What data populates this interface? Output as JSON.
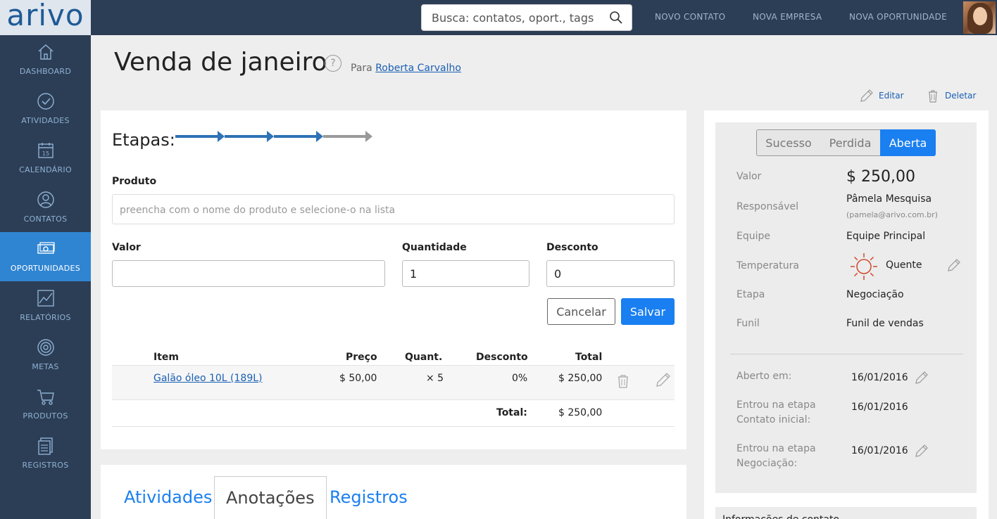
{
  "app": {
    "logo_text": "arivo"
  },
  "topbar": {
    "search_placeholder": "Busca: contatos, oport., tags",
    "links": [
      "NOVO CONTATO",
      "NOVA EMPRESA",
      "NOVA OPORTUNIDADE"
    ]
  },
  "sidebar": {
    "items": [
      {
        "label": "DASHBOARD",
        "icon": "home-icon"
      },
      {
        "label": "ATIVIDADES",
        "icon": "check-circle-icon"
      },
      {
        "label": "CALENDÁRIO",
        "icon": "calendar-icon",
        "badge": "15"
      },
      {
        "label": "CONTATOS",
        "icon": "user-icon"
      },
      {
        "label": "OPORTUNIDADES",
        "icon": "money-icon",
        "active": true
      },
      {
        "label": "RELATÓRIOS",
        "icon": "chart-icon"
      },
      {
        "label": "METAS",
        "icon": "target-icon"
      },
      {
        "label": "PRODUTOS",
        "icon": "cart-icon"
      },
      {
        "label": "REGISTROS",
        "icon": "records-icon"
      }
    ]
  },
  "header": {
    "title": "Venda de janeiro",
    "help": "?",
    "para_prefix": "Para",
    "para_name": "Roberta Carvalho",
    "edit_label": "Editar",
    "delete_label": "Deletar"
  },
  "form": {
    "etapas_label": "Etapas:",
    "stages_completed": 3,
    "stages_total": 4,
    "produto_label": "Produto",
    "produto_placeholder": "preencha com o nome do produto e selecione-o na lista",
    "valor_label": "Valor",
    "valor_value": "",
    "quantidade_label": "Quantidade",
    "quantidade_value": "1",
    "desconto_label": "Desconto",
    "desconto_value": "0",
    "cancel_label": "Cancelar",
    "save_label": "Salvar"
  },
  "table": {
    "headers": {
      "item": "Item",
      "preco": "Preço",
      "quant": "Quant.",
      "desconto": "Desconto",
      "total": "Total"
    },
    "rows": [
      {
        "item": "Galão óleo 10L (189L)",
        "preco": "$ 50,00",
        "quant": "× 5",
        "desconto": "0%",
        "total": "$ 250,00"
      }
    ],
    "total_label": "Total:",
    "total_value": "$ 250,00"
  },
  "tabs": [
    "Atividades",
    "Anotações",
    "Registros"
  ],
  "status": {
    "options": [
      "Sucesso",
      "Perdida",
      "Aberta"
    ],
    "selected": "Aberta"
  },
  "details": {
    "valor_label": "Valor",
    "valor": "$ 250,00",
    "responsavel_label": "Responsável",
    "responsavel_name": "Pâmela Mesquisa",
    "responsavel_email": "(pamela@arivo.com.br)",
    "equipe_label": "Equipe",
    "equipe": "Equipe Principal",
    "temperatura_label": "Temperatura",
    "temperatura": "Quente",
    "etapa_label": "Etapa",
    "etapa": "Negociação",
    "funil_label": "Funil",
    "funil": "Funil de vendas",
    "aberto_label": "Aberto em:",
    "aberto": "16/01/2016",
    "etapa_inicial_label_1": "Entrou na etapa",
    "etapa_inicial_label_2": "Contato inicial:",
    "etapa_inicial": "16/01/2016",
    "etapa_neg_label_1": "Entrou na etapa",
    "etapa_neg_label_2": "Negociação:",
    "etapa_neg": "16/01/2016"
  },
  "contact_info_title": "Informações de contato",
  "colors": {
    "primary": "#1a7ff0",
    "nav_bg": "#2c3e55",
    "active_nav": "#2f85d2",
    "stage_done": "#2f72b5",
    "stage_todo": "#999999"
  }
}
